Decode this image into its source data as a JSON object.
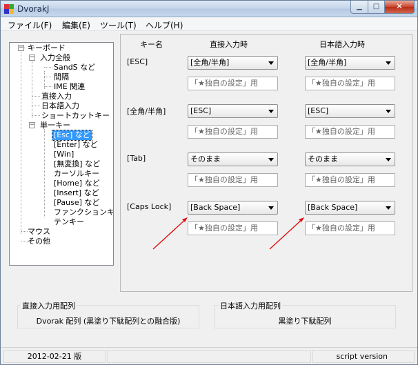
{
  "window": {
    "title": "DvorakJ"
  },
  "menu": [
    {
      "label": "ファイル(F)"
    },
    {
      "label": "編集(E)"
    },
    {
      "label": "ツール(T)"
    },
    {
      "label": "ヘルプ(H)"
    }
  ],
  "tree": {
    "keyboard": "キーボード",
    "input_full": "入力全般",
    "sands": "SandS など",
    "interval": "間隔",
    "ime": "IME 関連",
    "direct_input": "直接入力",
    "japanese_input": "日本語入力",
    "shortcut_key": "ショートカットキー",
    "single_key": "単一キー",
    "esc_etc": "[Esc] など",
    "enter_etc": "[Enter] など",
    "win": "[Win]",
    "muhenkan_etc": "[無変換] など",
    "cursor_key": "カーソルキー",
    "home_etc": "[Home] など",
    "insert_etc": "[Insert] など",
    "pause_etc": "[Pause] など",
    "function_key": "ファンクションキー",
    "tenkey": "テンキー",
    "mouse": "マウス",
    "other": "その他"
  },
  "columns": {
    "key_name": "キー名",
    "direct": "直接入力時",
    "japanese": "日本語入力時"
  },
  "rows": [
    {
      "key": "[ESC]",
      "direct": "[全角/半角]",
      "japanese": "[全角/半角]",
      "custom": "「★独自の設定」用"
    },
    {
      "key": "[全角/半角]",
      "direct": "[ESC]",
      "japanese": "[ESC]",
      "custom": "「★独自の設定」用"
    },
    {
      "key": "[Tab]",
      "direct": "そのまま",
      "japanese": "そのまま",
      "custom": "「★独自の設定」用"
    },
    {
      "key": "[Caps Lock]",
      "direct": "[Back Space]",
      "japanese": "[Back Space]",
      "custom": "「★独自の設定」用"
    }
  ],
  "layouts": {
    "direct_label": "直接入力用配列",
    "direct_value": "Dvorak 配列 (黒塗り下駄配列との融合版)",
    "japanese_label": "日本語入力用配列",
    "japanese_value": "黒塗り下駄配列"
  },
  "status": {
    "version": "2012-02-21 版",
    "script": "script version"
  },
  "colors": {
    "selection": "#3399ff",
    "arrow": "#e01010",
    "close_button": "#c8452f"
  }
}
